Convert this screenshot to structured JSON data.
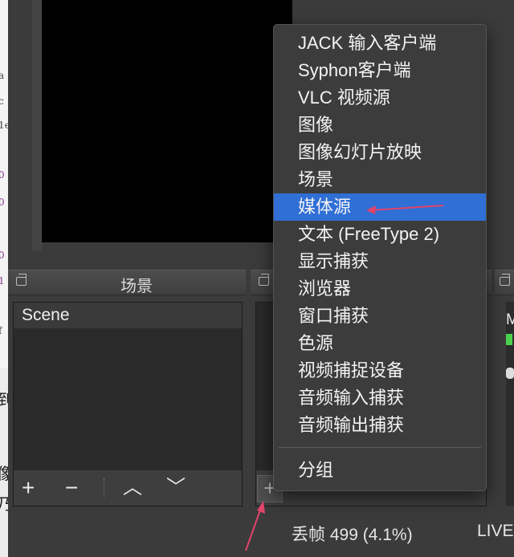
{
  "menu": {
    "items": [
      {
        "label": "JACK 输入客户端"
      },
      {
        "label": "Syphon客户端"
      },
      {
        "label": "VLC 视频源"
      },
      {
        "label": "图像"
      },
      {
        "label": "图像幻灯片放映"
      },
      {
        "label": "场景"
      },
      {
        "label": "媒体源"
      },
      {
        "label": "文本 (FreeType 2)"
      },
      {
        "label": "显示捕获"
      },
      {
        "label": "浏览器"
      },
      {
        "label": "窗口捕获"
      },
      {
        "label": "色源"
      },
      {
        "label": "视频捕捉设备"
      },
      {
        "label": "音频输入捕获"
      },
      {
        "label": "音频输出捕获"
      }
    ],
    "group_label": "分组",
    "selected_index": 6
  },
  "scenes": {
    "title": "场景",
    "items": [
      "Scene"
    ],
    "toolbar": {
      "add": "+",
      "remove": "−",
      "up": "︿",
      "down": "﹀"
    }
  },
  "sources": {
    "add": "+"
  },
  "mixer": {
    "fragment": "M"
  },
  "status": {
    "dropped_frames": "丢帧 499 (4.1%)",
    "live": "LIVE"
  },
  "background_doc": {
    "fragments": [
      "a",
      "c",
      "1e",
      "0",
      "0",
      "0",
      "1",
      "f",
      "到",
      "像",
      "乃"
    ]
  },
  "colors": {
    "menu_bg": "#3c3c3c",
    "selection": "#2f6fd6",
    "arrow": "#e0446a"
  }
}
